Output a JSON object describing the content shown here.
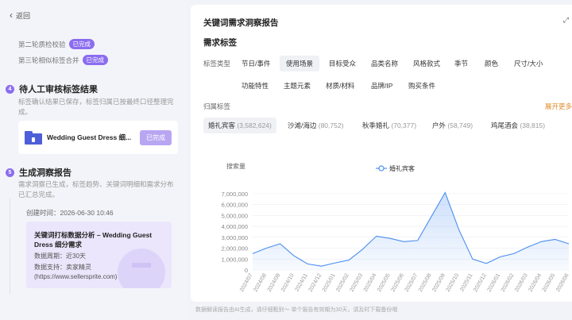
{
  "left": {
    "back_label": "返回",
    "rounds": [
      {
        "label": "第二轮质检校验",
        "badge": "已完成"
      },
      {
        "label": "第三轮相似标签合并",
        "badge": "已完成"
      }
    ],
    "step4": {
      "num": "4",
      "title": "待人工审核标签结果",
      "desc": "标签确认结果已保存，标签归属已按最终口径整理完成。"
    },
    "file": {
      "name": "Wedding Guest Dress 细...",
      "status": "已完成"
    },
    "step5": {
      "num": "5",
      "title": "生成洞察报告",
      "desc": "需求洞察已生成，标签趋势、关键词明细和需求分布已汇总完成。"
    },
    "created": "创建时间：2026-06-30 10:46",
    "report": {
      "title": "关键词打标数据分析 – Wedding Guest Dress 细分需求",
      "period": "数据周期：近30天",
      "support": "数据支持：卖家精灵",
      "url": "(https://www.sellersprite.com)"
    }
  },
  "right": {
    "title": "关键词需求洞察报告",
    "section": "需求标签",
    "tag_type_label": "标签类型",
    "tag_types_row1": [
      "节日/事件",
      "使用场景",
      "目标受众",
      "品类名称",
      "风格款式",
      "季节",
      "颜色",
      "尺寸/大小"
    ],
    "tag_types_row2": [
      "功能特性",
      "主题元素",
      "材质/材料",
      "品牌/IP",
      "购买条件"
    ],
    "selected_type": "使用场景",
    "belong_label": "归属标签",
    "more_label": "展开更多",
    "belong_tags": [
      {
        "name": "婚礼宾客",
        "count": "(3,582,624)"
      },
      {
        "name": "沙滩/海边",
        "count": "(80,752)"
      },
      {
        "name": "秋季婚礼",
        "count": "(70,377)"
      },
      {
        "name": "户外",
        "count": "(58,749)"
      },
      {
        "name": "鸡尾酒会",
        "count": "(38,815)"
      }
    ]
  },
  "footnote": "数据解读报告由AI生成，请仔细甄别～ 单个报告有效期为30天，请及时下载备份哦",
  "chart_data": {
    "type": "area",
    "ylabel": "搜索量",
    "yticks": [
      "0",
      "1,000,000",
      "2,000,000",
      "3,000,000",
      "4,000,000",
      "5,000,000",
      "6,000,000",
      "7,000,000"
    ],
    "ylim": [
      0,
      7500000
    ],
    "legend_position": "top-center",
    "color": "#4a8ef0",
    "x": [
      "2024/07",
      "2024/08",
      "2024/09",
      "2024/10",
      "2024/11",
      "2024/12",
      "2025/01",
      "2025/02",
      "2025/03",
      "2025/04",
      "2025/05",
      "2025/06",
      "2025/07",
      "2025/08",
      "2025/09",
      "2025/10",
      "2025/11",
      "2025/12",
      "2026/01",
      "2026/02",
      "2026/03",
      "2026/04",
      "2026/05",
      "2026/06"
    ],
    "series": [
      {
        "name": "婚礼宾客",
        "values": [
          1500000,
          2000000,
          2400000,
          1300000,
          550000,
          350000,
          650000,
          900000,
          1900000,
          3100000,
          2900000,
          2600000,
          2700000,
          4900000,
          7100000,
          3700000,
          1000000,
          600000,
          1200000,
          1500000,
          2100000,
          2600000,
          2800000,
          2400000
        ]
      }
    ]
  }
}
